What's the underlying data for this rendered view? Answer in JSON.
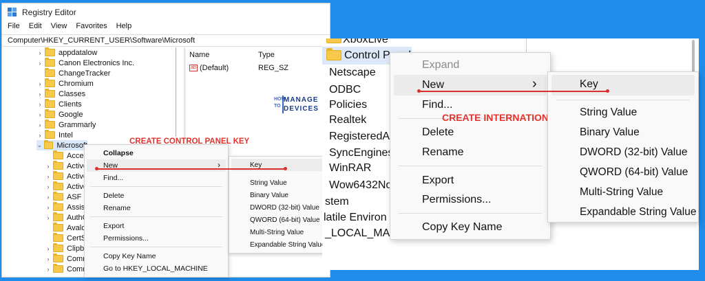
{
  "left": {
    "title": "Registry Editor",
    "menu": [
      "File",
      "Edit",
      "View",
      "Favorites",
      "Help"
    ],
    "address": "Computer\\HKEY_CURRENT_USER\\Software\\Microsoft",
    "tree": [
      "appdatalow",
      "Canon Electronics Inc.",
      "ChangeTracker",
      "Chromium",
      "Classes",
      "Clients",
      "Google",
      "Grammarly",
      "Intel",
      "Microsoft",
      "Acces",
      "Active",
      "Active",
      "Active",
      "ASF S",
      "Assist",
      "AuthC",
      "Avalo",
      "CertS",
      "Clipbo",
      "Comm",
      "Comm"
    ],
    "values_header": {
      "name": "Name",
      "type": "Type"
    },
    "value_row": {
      "name": "(Default)",
      "type": "REG_SZ",
      "icon_text": "ab"
    },
    "context_menu": {
      "collapse": "Collapse",
      "new": "New",
      "find": "Find...",
      "delete": "Delete",
      "rename": "Rename",
      "export": "Export",
      "permissions": "Permissions...",
      "copy_key_name": "Copy Key Name",
      "goto": "Go to HKEY_LOCAL_MACHINE",
      "arrow": "›"
    },
    "submenu": [
      "Key",
      "String Value",
      "Binary Value",
      "DWORD (32-bit) Value",
      "QWORD (64-bit) Value",
      "Multi-String Value",
      "Expandable String Value"
    ],
    "annotation": "CREATE CONTROL PANEL KEY"
  },
  "logo": {
    "how": "HOW",
    "to": "TO",
    "manage": "MANAGE",
    "devices": "DEVICES"
  },
  "right": {
    "tree": [
      "XboxLive",
      "Control Panel",
      "Netscape",
      "ODBC",
      "Policies",
      "Realtek",
      "RegisteredA",
      "SyncEngines",
      "WinRAR",
      "Wow6432No",
      "stem",
      "latile Environ",
      "_LOCAL_MA"
    ],
    "context_menu": {
      "expand": "Expand",
      "new": "New",
      "find": "Find...",
      "delete": "Delete",
      "rename": "Rename",
      "export": "Export",
      "permissions": "Permissions...",
      "copy_key_name": "Copy Key Name",
      "arrow": "›"
    },
    "submenu": [
      "Key",
      "String Value",
      "Binary Value",
      "DWORD (32-bit) Value",
      "QWORD (64-bit) Value",
      "Multi-String Value",
      "Expandable String Value"
    ],
    "annotation": "CREATE INTERNATIONAL KEY"
  },
  "colors": {
    "background": "#1f8ceb",
    "annotation": "#e4332d",
    "folder": "#f6c94a"
  }
}
